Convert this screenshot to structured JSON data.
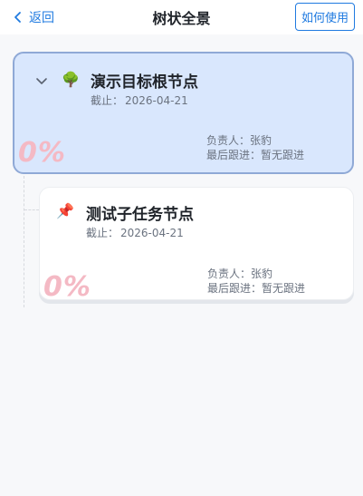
{
  "header": {
    "back_label": "返回",
    "title": "树状全景",
    "help_label": "如何使用"
  },
  "root_node": {
    "icon": "🌳",
    "icon_name": "tree-icon",
    "title": "演示目标根节点",
    "deadline_label": "截止：",
    "deadline": "2026-04-21",
    "owner_label": "负责人：",
    "owner": "张豹",
    "followup_label": "最后跟进：",
    "followup": "暂无跟进",
    "progress": "0%",
    "expanded": true
  },
  "child_nodes": [
    {
      "icon": "📌",
      "icon_name": "pushpin-icon",
      "title": "测试子任务节点",
      "deadline_label": "截止：",
      "deadline": "2026-04-21",
      "owner_label": "负责人：",
      "owner": "张豹",
      "followup_label": "最后跟进：",
      "followup": "暂无跟进",
      "progress": "0%"
    }
  ],
  "colors": {
    "accent": "#1f7ae0",
    "root_card_bg": "#d9e7fd",
    "root_card_border": "#8fa9d6",
    "progress_text": "#f4b9c4"
  }
}
